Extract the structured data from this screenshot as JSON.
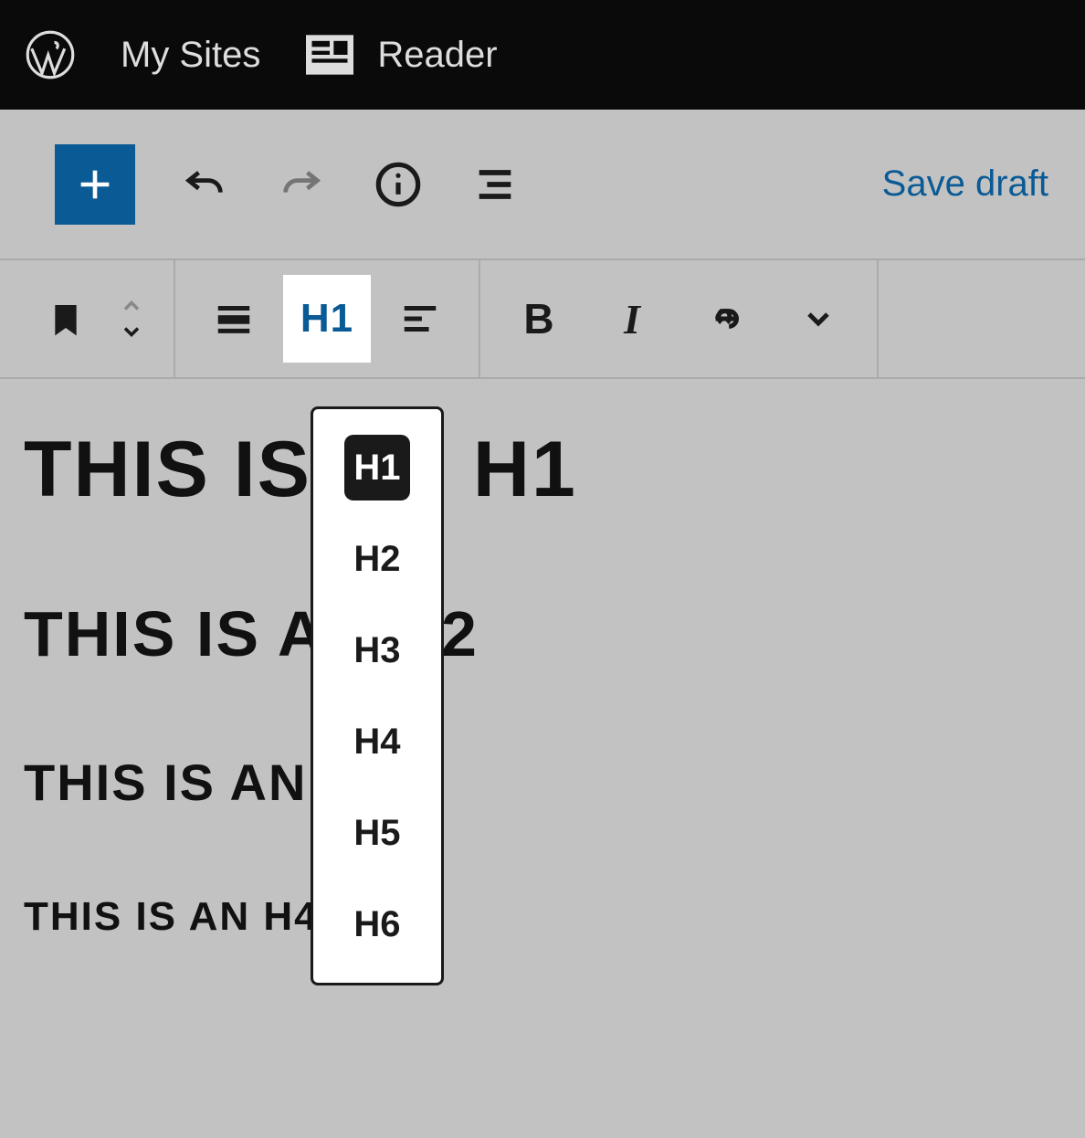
{
  "adminbar": {
    "my_sites_label": "My Sites",
    "reader_label": "Reader"
  },
  "editor_toolbar": {
    "add_block": "plus-icon",
    "undo": "undo-icon",
    "redo": "redo-icon",
    "info": "info-icon",
    "outline": "outline-icon",
    "save_draft_label": "Save draft"
  },
  "block_toolbar": {
    "block_type": "heading-block",
    "movers": "movers",
    "align": "align-icon",
    "heading_level_label": "H1",
    "text_align": "align-left-icon",
    "bold_label": "B",
    "italic_label": "I",
    "link": "link-icon",
    "more": "chevron-down-icon"
  },
  "content": {
    "h1_text": "THIS IS AN H1",
    "h2_text": "THIS IS AN H2",
    "h3_text": "THIS IS AN H3",
    "h4_text": "THIS IS AN H4"
  },
  "heading_dropdown": {
    "items": [
      {
        "label": "H1",
        "selected": true
      },
      {
        "label": "H2",
        "selected": false
      },
      {
        "label": "H3",
        "selected": false
      },
      {
        "label": "H4",
        "selected": false
      },
      {
        "label": "H5",
        "selected": false
      },
      {
        "label": "H6",
        "selected": false
      }
    ]
  }
}
